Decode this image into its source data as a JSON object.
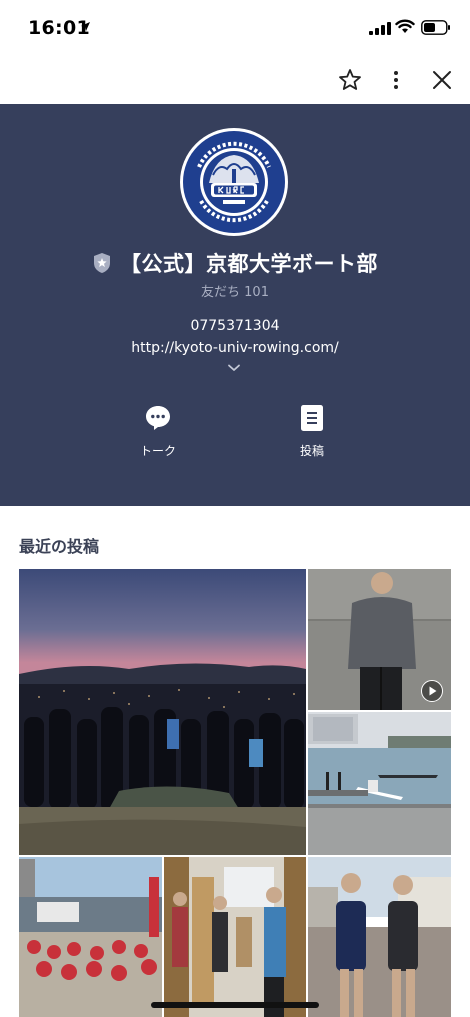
{
  "status_bar": {
    "time": "16:01"
  },
  "toolbar": {
    "icons": [
      "star-icon",
      "more-vertical-icon",
      "close-icon"
    ]
  },
  "profile": {
    "account_name": "【公式】京都大学ボート部",
    "friends_label": "友だち 101",
    "phone": "0775371304",
    "website": "http://kyoto-univ-rowing.com/",
    "actions": [
      {
        "label": "トーク",
        "icon": "chat-bubble-icon"
      },
      {
        "label": "投稿",
        "icon": "post-document-icon"
      }
    ],
    "colors": {
      "background": "#363f5c",
      "badge": "#a9afc2"
    }
  },
  "recent_posts": {
    "title": "最近の投稿"
  }
}
